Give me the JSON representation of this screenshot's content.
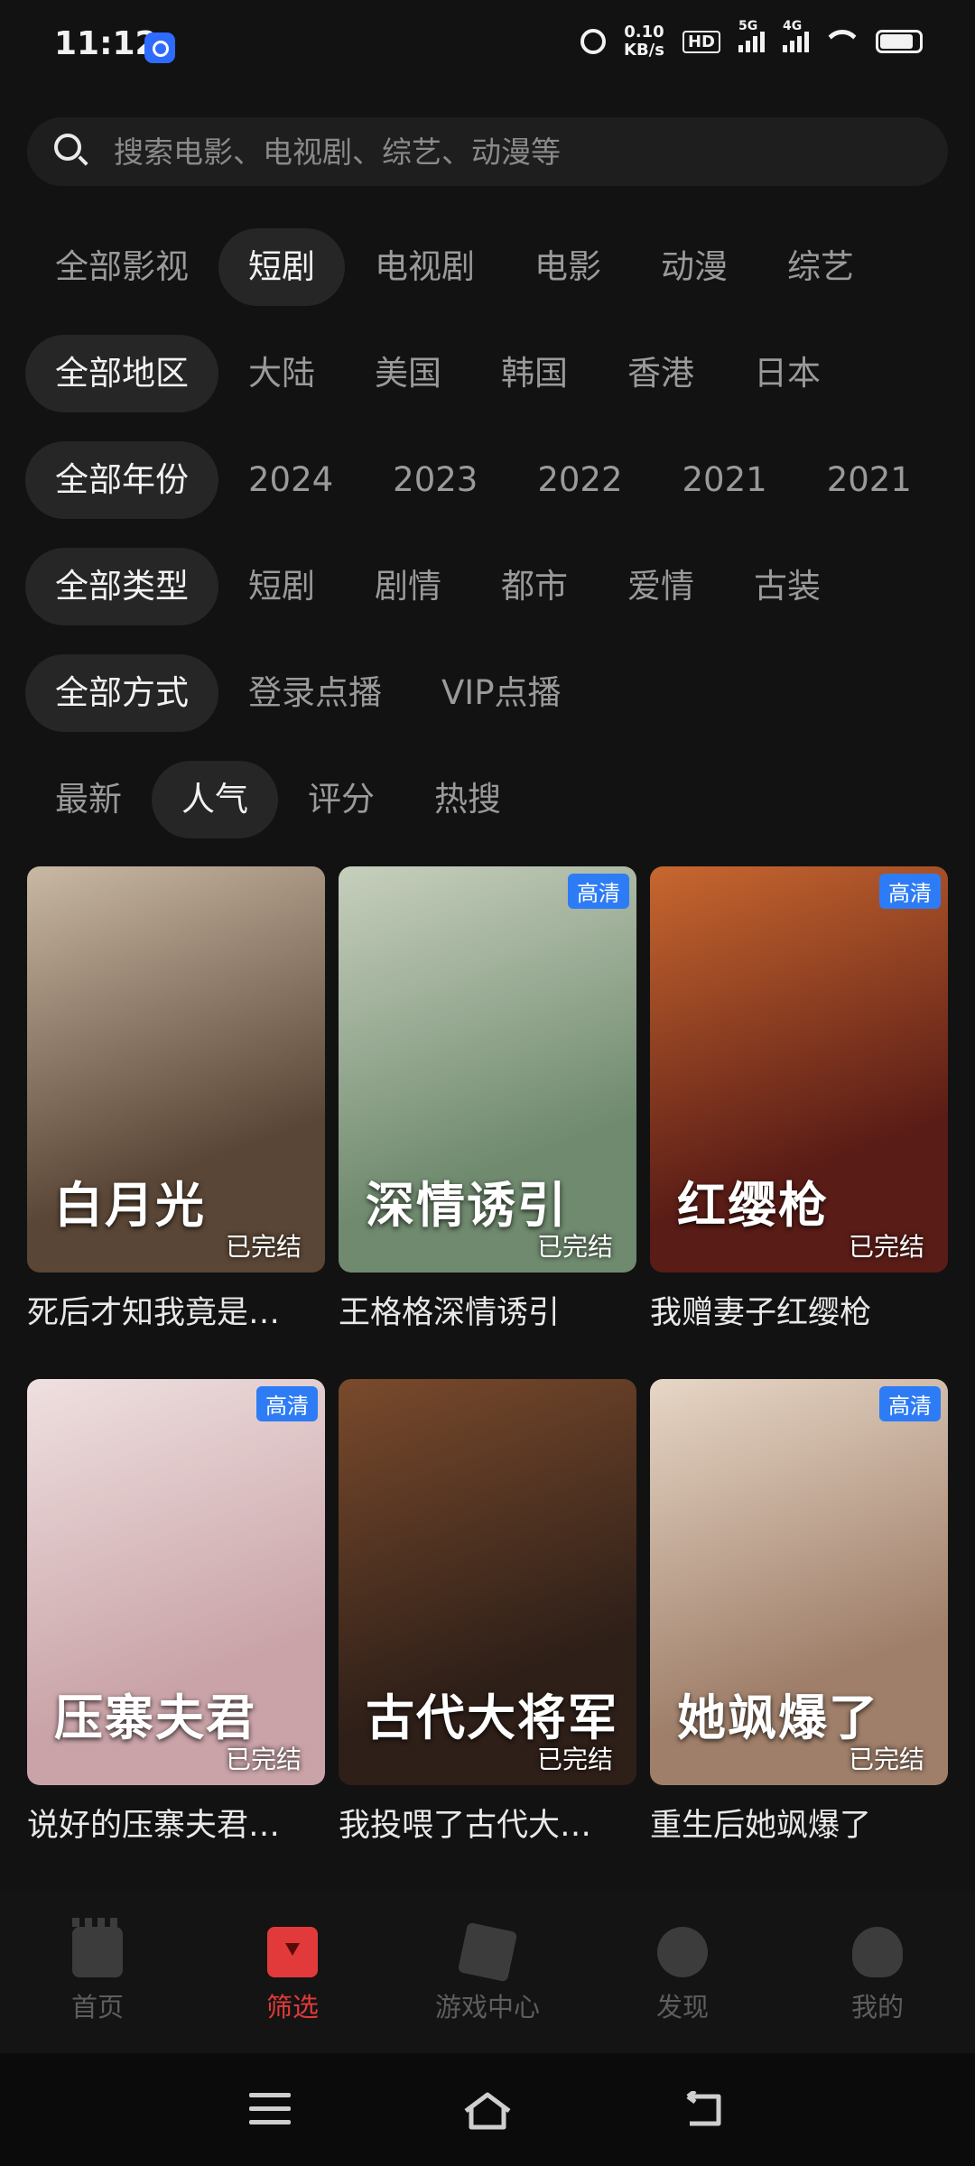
{
  "status_bar": {
    "time": "11:12",
    "net_speed_value": "0.10",
    "net_speed_unit": "KB/s",
    "hd_label": "HD",
    "sig1": "5G",
    "sig2": "4G"
  },
  "search": {
    "placeholder": "搜索电影、电视剧、综艺、动漫等"
  },
  "filters": {
    "categories": [
      "全部影视",
      "短剧",
      "电视剧",
      "电影",
      "动漫",
      "综艺"
    ],
    "categories_active": 1,
    "regions": [
      "全部地区",
      "大陆",
      "美国",
      "韩国",
      "香港",
      "日本"
    ],
    "years": [
      "全部年份",
      "2024",
      "2023",
      "2022",
      "2021",
      "2021"
    ],
    "genres": [
      "全部类型",
      "短剧",
      "剧情",
      "都市",
      "爱情",
      "古装"
    ],
    "modes": [
      "全部方式",
      "登录点播",
      "VIP点播"
    ],
    "sort": [
      "最新",
      "人气",
      "评分",
      "热搜"
    ],
    "sort_active": 1
  },
  "items": [
    {
      "title": "死后才知我竟是…",
      "status": "已完结",
      "hd": "",
      "poster_text": "白月光",
      "c1": "#5a4636",
      "c2": "#c9b8a4"
    },
    {
      "title": "王格格深情诱引",
      "status": "已完结",
      "hd": "高清",
      "poster_text": "深情诱引",
      "c1": "#6f8a6e",
      "c2": "#c7cfbd"
    },
    {
      "title": "我赠妻子红缨枪",
      "status": "已完结",
      "hd": "高清",
      "poster_text": "红缨枪",
      "c1": "#5a1c16",
      "c2": "#c8672f"
    },
    {
      "title": "说好的压寨夫君…",
      "status": "已完结",
      "hd": "高清",
      "poster_text": "压寨夫君",
      "c1": "#c9a3a8",
      "c2": "#efe0df"
    },
    {
      "title": "我投喂了古代大…",
      "status": "已完结",
      "hd": "",
      "poster_text": "古代大将军",
      "c1": "#2e1f18",
      "c2": "#7a4a2c"
    },
    {
      "title": "重生后她飒爆了",
      "status": "已完结",
      "hd": "高清",
      "poster_text": "她飒爆了",
      "c1": "#9f7f6a",
      "c2": "#e7d6c6"
    }
  ],
  "bottom_nav": [
    {
      "label": "首页",
      "icon": "home-icon",
      "active": false
    },
    {
      "label": "筛选",
      "icon": "filter-icon",
      "active": true
    },
    {
      "label": "游戏中心",
      "icon": "game-center-icon",
      "active": false
    },
    {
      "label": "发现",
      "icon": "discover-icon",
      "active": false
    },
    {
      "label": "我的",
      "icon": "profile-icon",
      "active": false
    }
  ],
  "colors": {
    "background": "#121212",
    "accent": "#e23a3a",
    "badge": "#2d7cf6"
  }
}
